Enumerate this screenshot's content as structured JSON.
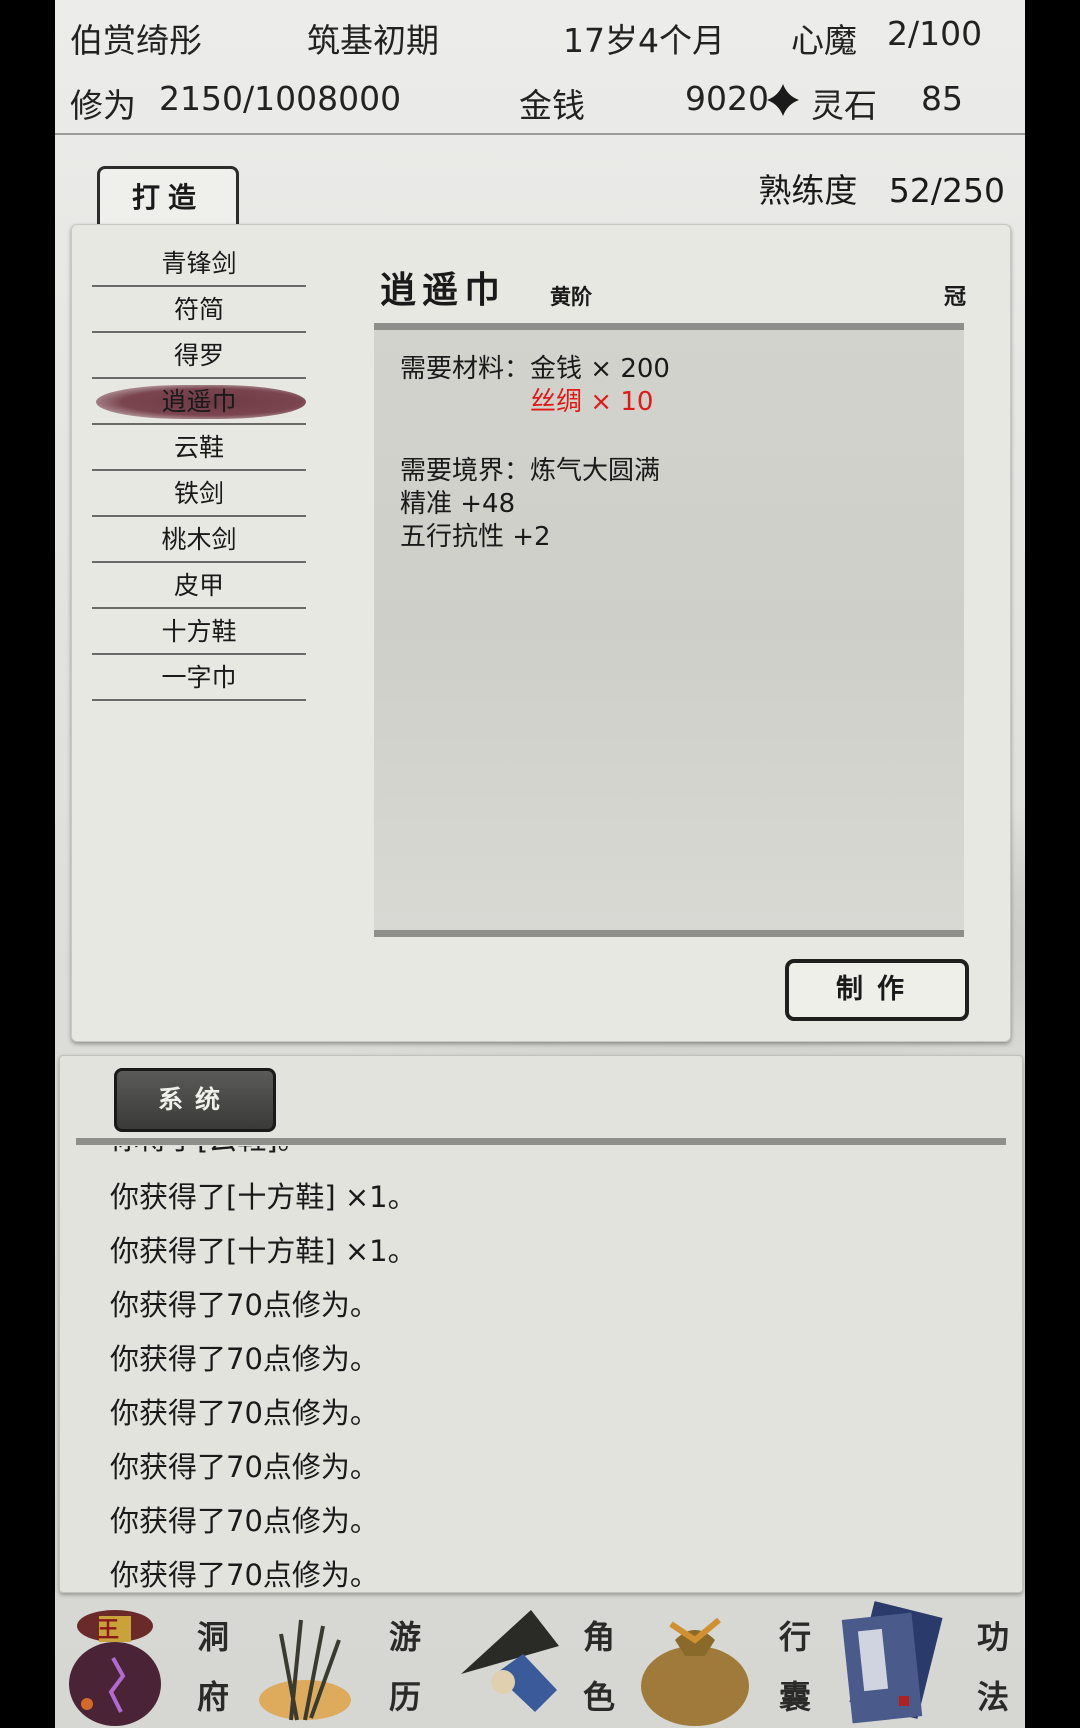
{
  "header": {
    "name": "伯赏绮彤",
    "realm": "筑基初期",
    "age": "17岁4个月",
    "heart_demon_label": "心魔",
    "heart_demon_value": "2/100",
    "cultivation_label": "修为",
    "cultivation_value": "2150/1008000",
    "money_label": "金钱",
    "money_value": "9020",
    "spirit_stone_label": "灵石",
    "spirit_stone_value": "85"
  },
  "forge": {
    "tab_label": "打造",
    "proficiency_label": "熟练度",
    "proficiency_value": "52/250",
    "recipes": [
      "青锋剑",
      "符简",
      "得罗",
      "逍遥巾",
      "云鞋",
      "铁剑",
      "桃木剑",
      "皮甲",
      "十方鞋",
      "一字巾"
    ],
    "selected_index": 3,
    "detail": {
      "name": "逍遥巾",
      "grade": "黄阶",
      "slot": "冠",
      "materials_label": "需要材料：",
      "material_1": "金钱  × 200",
      "material_2": "丝绸  × 10",
      "realm_req": "需要境界：炼气大圆满",
      "stat_1": "精准 +48",
      "stat_2": "五行抗性 +2"
    },
    "make_button": "制作"
  },
  "log": {
    "tab_label": "系统",
    "cut_line": "你得了[云鞋]。",
    "lines": [
      "你获得了[十方鞋] ×1。",
      "你获得了[十方鞋] ×1。",
      "你获得了70点修为。",
      "你获得了70点修为。",
      "你获得了70点修为。",
      "你获得了70点修为。",
      "你获得了70点修为。",
      "你获得了70点修为。"
    ]
  },
  "nav": {
    "cave_top": "洞",
    "cave_bottom": "府",
    "travel_top": "游",
    "travel_bottom": "历",
    "role_top": "角",
    "role_bottom": "色",
    "bag_top": "行",
    "bag_bottom": "囊",
    "skill_top": "功",
    "skill_bottom": "法",
    "seal_char": "王"
  },
  "colors": {
    "shortage": "#e01818",
    "selected_brush": "#6e3a44"
  }
}
